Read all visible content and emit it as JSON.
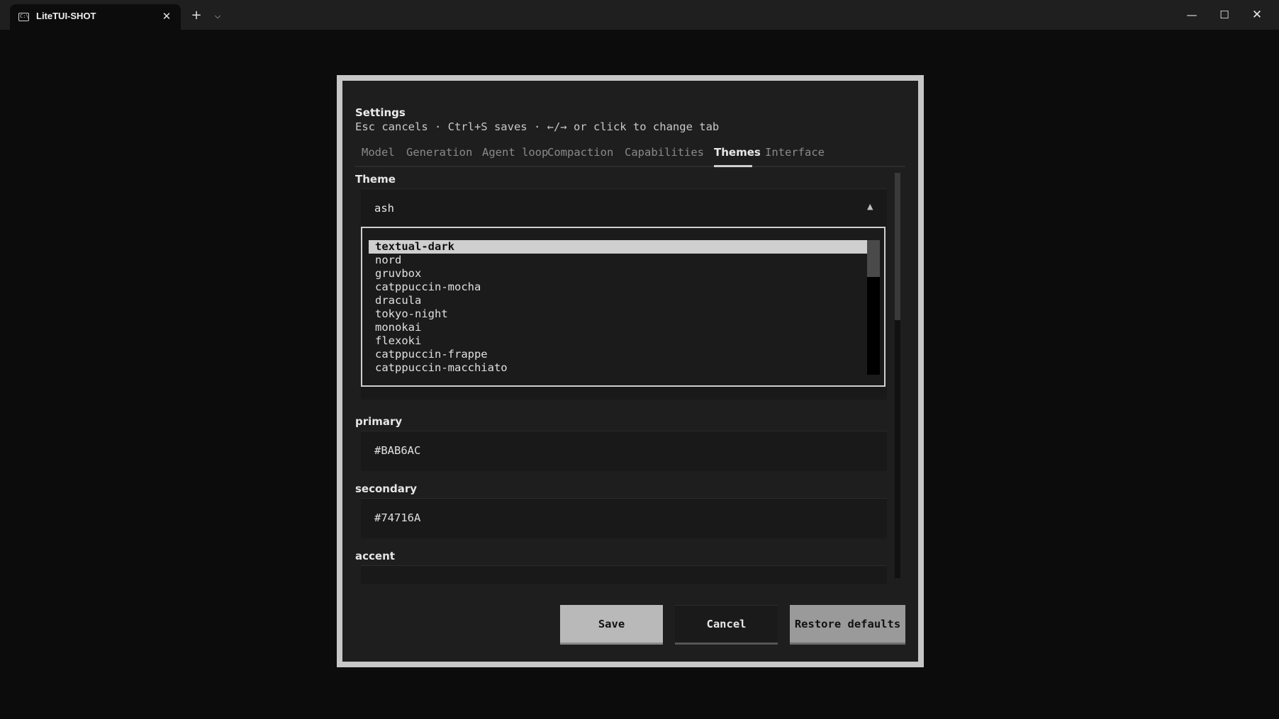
{
  "window": {
    "tab_title": "LiteTUI-SHOT",
    "tab_icon": "terminal-icon",
    "tab_icon_text": "C:\\",
    "close_glyph": "✕",
    "new_tab_glyph": "+",
    "dropdown_glyph": "⌵",
    "minimize_glyph": "—",
    "maximize_glyph": "☐",
    "window_close_glyph": "✕"
  },
  "dialog": {
    "title": "Settings",
    "subtitle": "Esc cancels · Ctrl+S saves · ←/→ or click to change tab",
    "tabs": [
      {
        "label": "Model",
        "active": false
      },
      {
        "label": "Generation",
        "active": false
      },
      {
        "label": "Agent loop",
        "active": false
      },
      {
        "label": "Compaction",
        "active": false
      },
      {
        "label": "Capabilities",
        "active": false
      },
      {
        "label": "Themes",
        "active": true
      },
      {
        "label": "Interface",
        "active": false
      }
    ],
    "theme": {
      "label": "Theme",
      "value": "ash",
      "arrow": "▲",
      "options": [
        "textual-dark",
        "nord",
        "gruvbox",
        "catppuccin-mocha",
        "dracula",
        "tokyo-night",
        "monokai",
        "flexoki",
        "catppuccin-frappe",
        "catppuccin-macchiato"
      ],
      "highlighted": "textual-dark"
    },
    "fields": [
      {
        "label": "primary",
        "value": "#BAB6AC"
      },
      {
        "label": "secondary",
        "value": "#74716A"
      },
      {
        "label": "accent",
        "value": ""
      }
    ],
    "buttons": {
      "save": "Save",
      "cancel": "Cancel",
      "restore": "Restore defaults"
    }
  },
  "colors": {
    "primary": "#BAB6AC",
    "secondary": "#74716A"
  }
}
